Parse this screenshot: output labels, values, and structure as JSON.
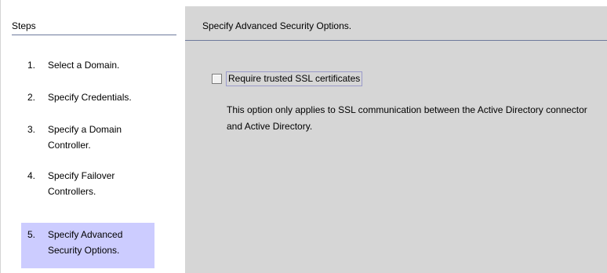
{
  "steps": {
    "title": "Steps",
    "items": [
      {
        "num": "1.",
        "label": "Select a Domain."
      },
      {
        "num": "2.",
        "label": "Specify Credentials."
      },
      {
        "num": "3.",
        "label": "Specify a Domain Controller."
      },
      {
        "num": "4.",
        "label": "Specify Failover Controllers."
      },
      {
        "num": "5.",
        "label": "Specify Advanced Security Options."
      }
    ],
    "active_index": 4
  },
  "content": {
    "title": "Specify Advanced Security Options.",
    "option": {
      "label": "Require trusted SSL certificates",
      "checked": false
    },
    "description": "This option only applies to SSL communication between the Active Directory connector and Active Directory."
  },
  "colors": {
    "active_step": "#ccccff",
    "content_bg": "#d6d6d6",
    "divider": "#6e7a9c"
  }
}
